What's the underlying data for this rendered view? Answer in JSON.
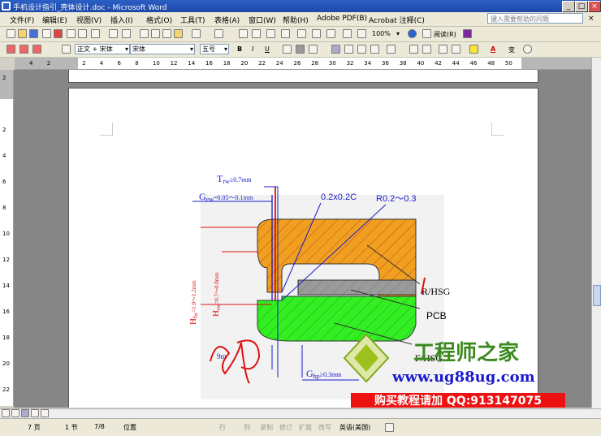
{
  "window": {
    "title": "手机设计指引_壳体设计.doc - Microsoft Word",
    "min": "_",
    "max": "□",
    "close": "×"
  },
  "menu": {
    "items": [
      "文件(F)",
      "编辑(E)",
      "视图(V)",
      "插入(I)",
      "格式(O)",
      "工具(T)",
      "表格(A)",
      "窗口(W)",
      "帮助(H)",
      "Adobe PDF(B)",
      "Acrobat 注释(C)"
    ],
    "help_placeholder": "键入需要帮助的问题",
    "close": "×"
  },
  "toolbar1": {
    "zoom": "100%",
    "read_label": "阅读(R)"
  },
  "toolbar2": {
    "style": "正文 + 宋体",
    "font": "宋体",
    "size": "五号",
    "bold": "B",
    "italic": "I",
    "underline": "U",
    "font_color_label": "A",
    "change_label": "变"
  },
  "ruler": {
    "h_ticks": [
      "4",
      "2",
      "",
      "2",
      "4",
      "6",
      "8",
      "10",
      "12",
      "14",
      "16",
      "18",
      "20",
      "22",
      "24",
      "26",
      "28",
      "30",
      "32",
      "34",
      "36",
      "38",
      "40",
      "42",
      "44",
      "46",
      "48",
      "50"
    ],
    "v_ticks": [
      "2",
      "",
      "2",
      "4",
      "6",
      "8",
      "10",
      "12",
      "14",
      "16",
      "18",
      "20",
      "22"
    ]
  },
  "drawing": {
    "trw": "T",
    "trw_sub": "rw",
    "trw_val": "≥0.7mm",
    "gew": "G",
    "gew_sub": "ew",
    "gew_val": "=0.05～0.1mm",
    "chamfer": "0.2x0.2C",
    "radius": "R0.2～0.3",
    "label_rhsg": "R/HSG",
    "label_pcb": "PCB",
    "label_fhsg": "F/HSG",
    "ghp": "G",
    "ghp_sub": "hp",
    "ghp_val": "≥0.3mm",
    "hfw": "H",
    "hfw_sub": "fw",
    "hfw_val": "=1.0～1.2mm",
    "hrw": "H",
    "hrw_sub": "rw",
    "hrw_val": "=0.7～0.8mm",
    "tfw_partial": "9m"
  },
  "watermark": {
    "brand": "工程师之家",
    "url": "www.ug88ug.com",
    "promo": "购买教程请加 QQ:913147075"
  },
  "status": {
    "page": "7 页",
    "section": "1 节",
    "pages": "7/8",
    "position": "位置",
    "rec": "行",
    "col": "列",
    "record": "录制",
    "revise": "修订",
    "extend": "扩展",
    "overwrite": "改写",
    "lang": "英语(美国)"
  },
  "colors": {
    "orange": "#f0a020",
    "green": "#33ee22",
    "gray": "#9a9a9a",
    "annot_blue": "#1a1acc",
    "red": "#dd1111"
  }
}
